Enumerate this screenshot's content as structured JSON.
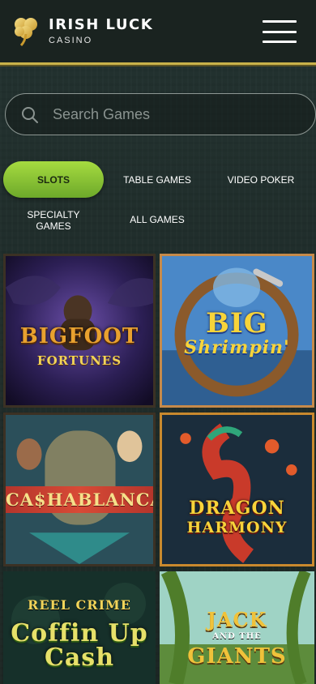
{
  "header": {
    "brand_title": "IRISH LUCK",
    "brand_subtitle": "CASINO",
    "logo_icon": "shamrock-icon",
    "menu_icon": "hamburger-menu-icon"
  },
  "search": {
    "placeholder": "Search Games",
    "value": ""
  },
  "tabs": [
    {
      "label": "SLOTS",
      "active": true
    },
    {
      "label": "TABLE GAMES",
      "active": false
    },
    {
      "label": "VIDEO POKER",
      "active": false
    },
    {
      "label": "SPECIALTY GAMES",
      "active": false
    },
    {
      "label": "ALL GAMES",
      "active": false
    }
  ],
  "games": [
    {
      "line1": "BIGFOOT",
      "line2": "FORTUNES"
    },
    {
      "line1": "BIG",
      "line2": "Shrimpin'"
    },
    {
      "line1": "CA$HABLANCA",
      "line2": ""
    },
    {
      "line1": "DRAGON",
      "line2": "HARMONY"
    },
    {
      "line1": "REEL CRIME",
      "line2": "Coffin Up Cash"
    },
    {
      "line1": "JACK",
      "line2": "AND THE",
      "line3": "GIANTS"
    }
  ],
  "colors": {
    "accent_green": "#8cc63f",
    "gold_border": "#c9b24a",
    "header_bg": "#1a2320",
    "page_bg": "#1e2a26"
  }
}
